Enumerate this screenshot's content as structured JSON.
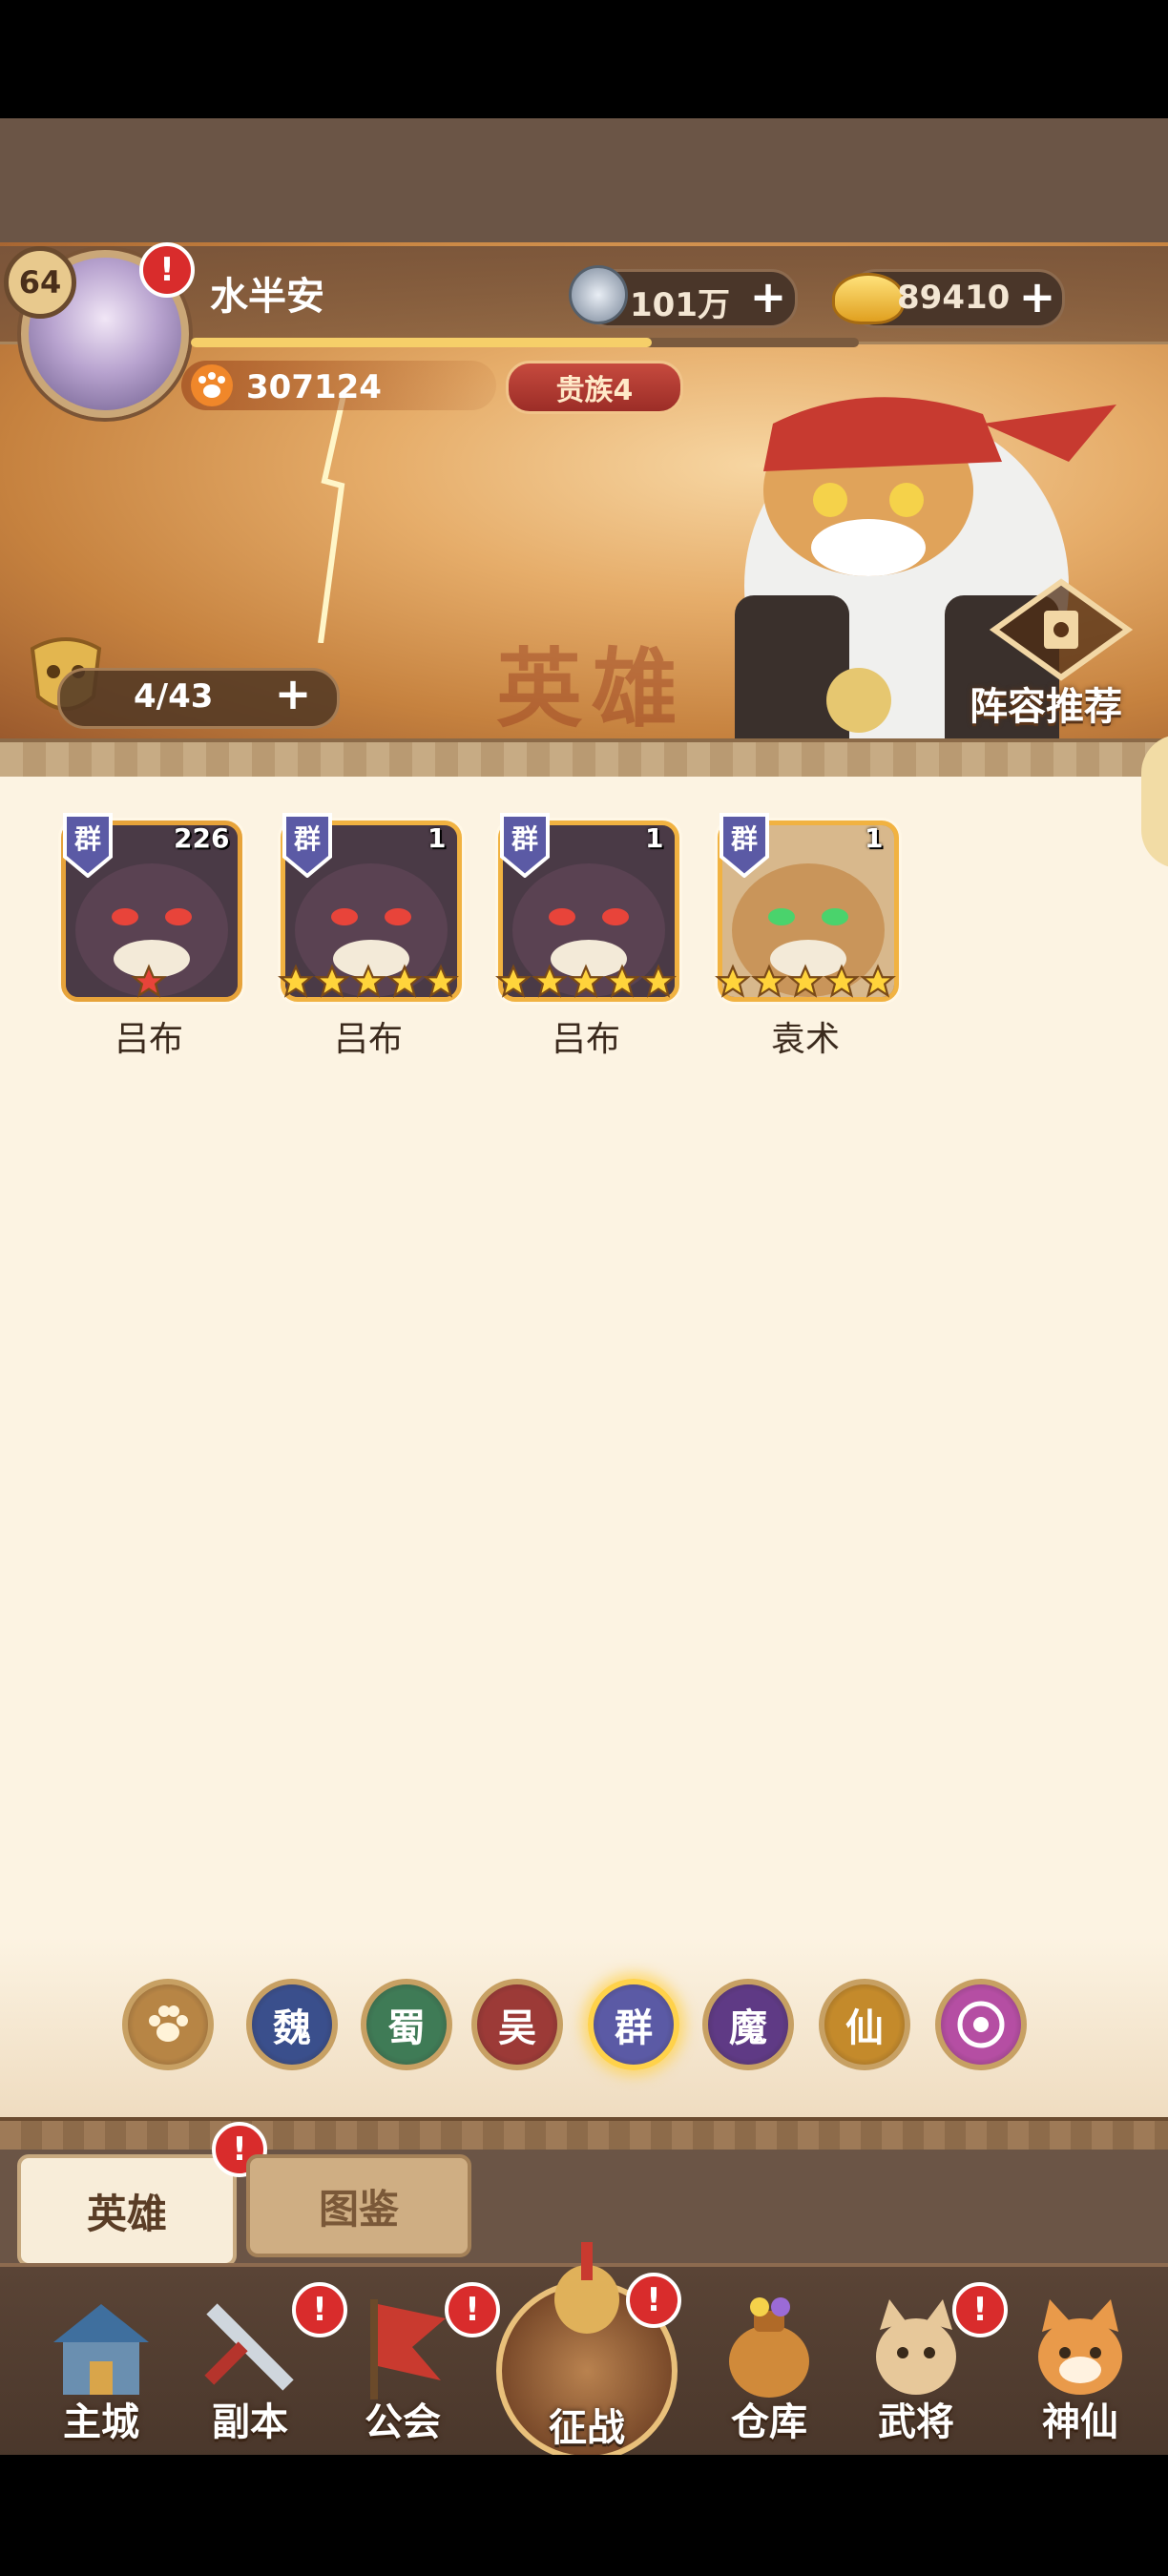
{
  "player": {
    "level": "64",
    "name": "水半安",
    "silver": "101万",
    "gold": "89410",
    "power": "307124",
    "vip": "贵族4",
    "exp_fraction": 0.69
  },
  "banner": {
    "bg_text": "英雄",
    "capacity": "4/43",
    "lineup_label": "阵容推荐"
  },
  "heroes": [
    {
      "name": "吕布",
      "faction": "群",
      "count": "226",
      "stars": 1,
      "star_color": "red"
    },
    {
      "name": "吕布",
      "faction": "群",
      "count": "1",
      "stars": 5,
      "star_color": "gold"
    },
    {
      "name": "吕布",
      "faction": "群",
      "count": "1",
      "stars": 5,
      "star_color": "gold"
    },
    {
      "name": "袁术",
      "faction": "群",
      "count": "1",
      "stars": 5,
      "star_color": "gold"
    }
  ],
  "factions": [
    {
      "label": "",
      "icon": "paw-icon",
      "color": "#b78545"
    },
    {
      "label": "魏",
      "color": "#3a4f8c"
    },
    {
      "label": "蜀",
      "color": "#3f7b56"
    },
    {
      "label": "吴",
      "color": "#9c3a37"
    },
    {
      "label": "群",
      "color": "#5b5aa5",
      "active": true
    },
    {
      "label": "魔",
      "color": "#5f3a85"
    },
    {
      "label": "仙",
      "color": "#c48a2b"
    },
    {
      "label": "",
      "icon": "swirl-icon",
      "color": "#b54ea3"
    }
  ],
  "tabs": {
    "heroes": "英雄",
    "codex": "图鉴"
  },
  "nav": {
    "main_city": "主城",
    "dungeon": "副本",
    "guild": "公会",
    "campaign": "征战",
    "warehouse": "仓库",
    "generals": "武将",
    "immortal": "神仙"
  },
  "colors": {
    "accent_gold": "#f6cf69",
    "alert_red": "#d92c2c",
    "panel_cream": "#fcf3e2"
  }
}
